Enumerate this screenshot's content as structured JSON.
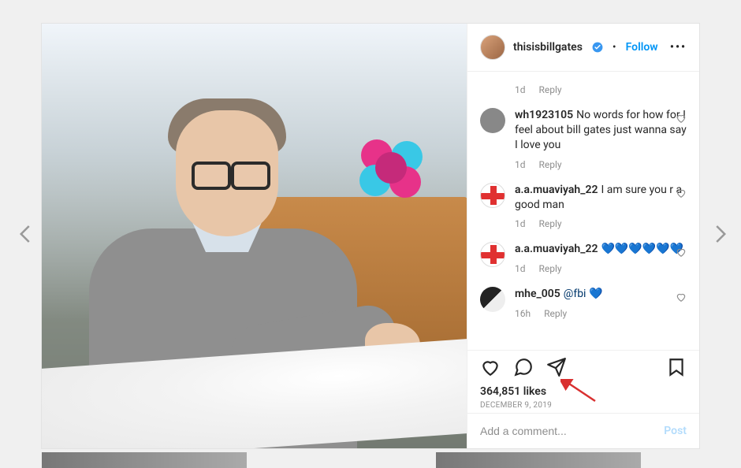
{
  "header": {
    "username": "thisisbillgates",
    "verified": true,
    "separator": "•",
    "follow_label": "Follow",
    "more_label": "•••"
  },
  "comments": [
    {
      "username": "",
      "text": "",
      "time": "1d",
      "reply": "Reply",
      "partial": true
    },
    {
      "username": "wh1923105",
      "text": "No words for how for I feel about bill gates just wanna say I love you",
      "time": "1d",
      "reply": "Reply",
      "avatar": "grey"
    },
    {
      "username": "a.a.muaviyah_22",
      "text": "I am sure you r a good man",
      "time": "1d",
      "reply": "Reply",
      "avatar": "flag"
    },
    {
      "username": "a.a.muaviyah_22",
      "text": "💙💙💙💙💙💙",
      "time": "1d",
      "reply": "Reply",
      "avatar": "flag"
    },
    {
      "username": "mhe_005",
      "mention": "@fbi",
      "text": "💙",
      "time": "16h",
      "reply": "Reply",
      "avatar": "bw"
    }
  ],
  "actions": {
    "likes": "364,851 likes",
    "date": "DECEMBER 9, 2019"
  },
  "compose": {
    "placeholder": "Add a comment...",
    "post_label": "Post"
  }
}
